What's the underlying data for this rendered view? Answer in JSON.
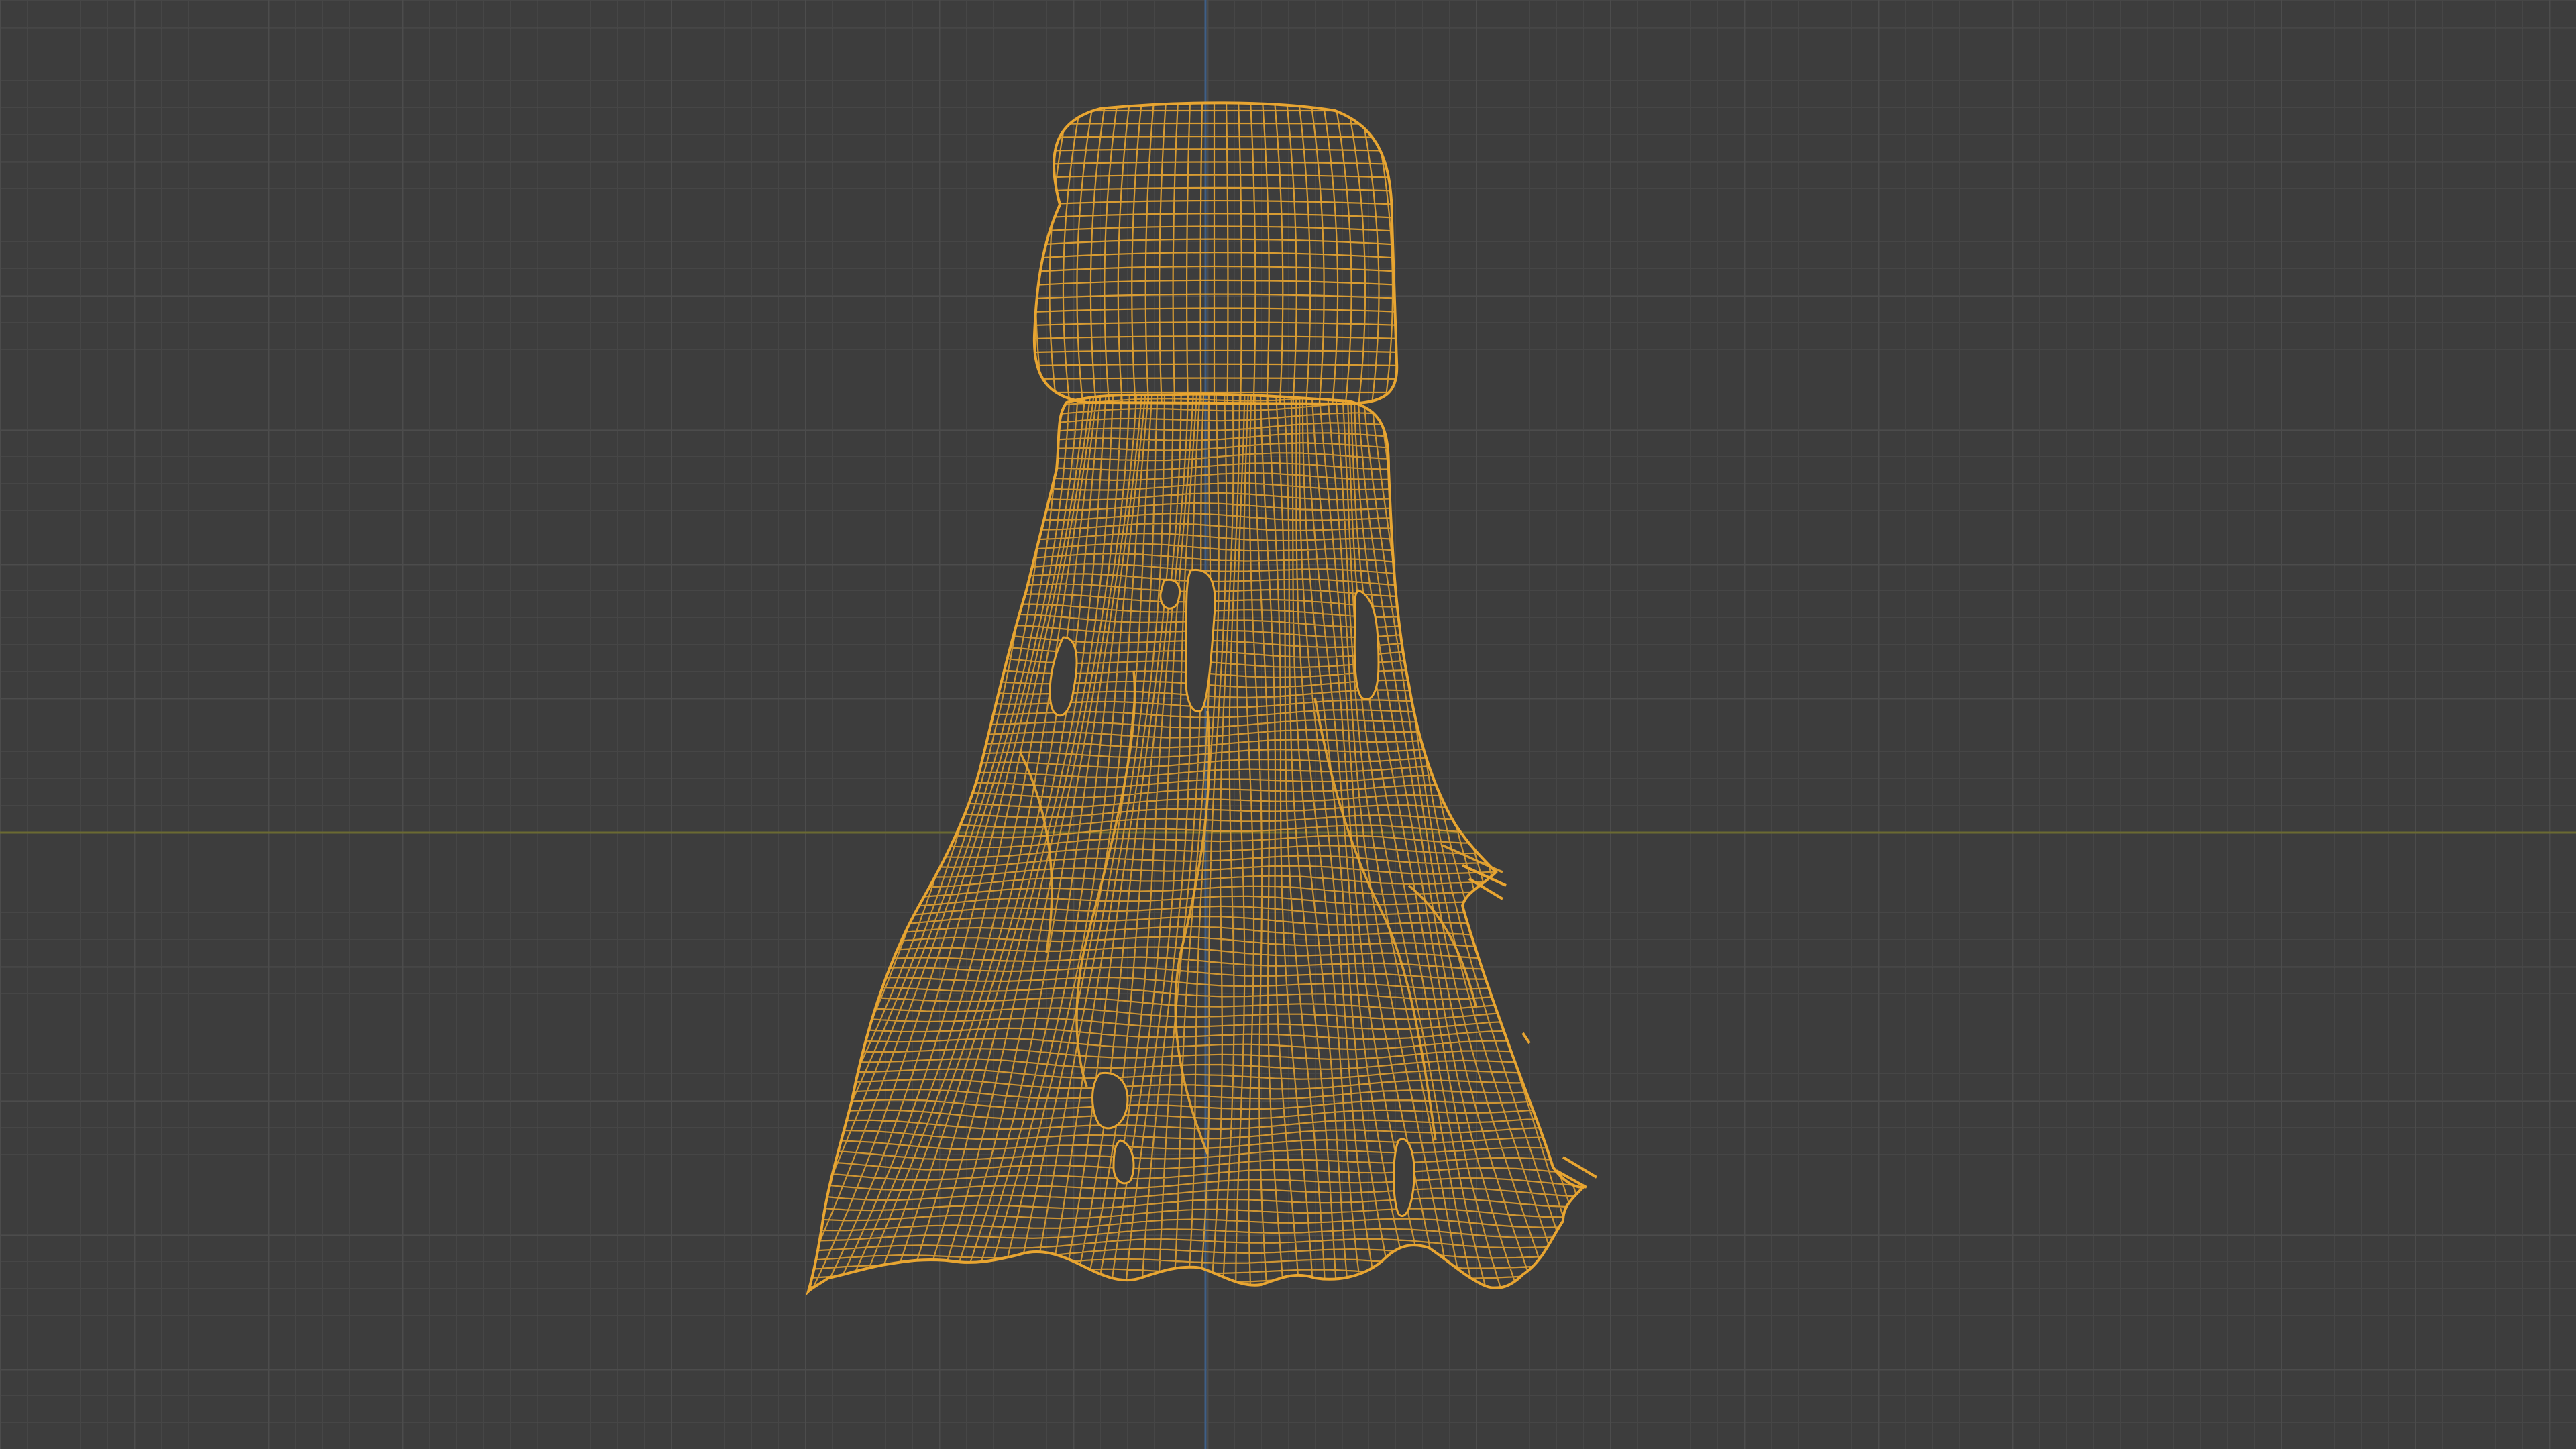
{
  "viewport": {
    "mode": "wireframe",
    "background_color": "#3d3d3d",
    "grid_minor_color": "#454545",
    "grid_major_color": "#4b4b4b",
    "axis_x_color": "#6e6a2e",
    "axis_z_color": "#3d5f8a",
    "wire_color": "#e8a531",
    "object": {
      "name": "tattered-cloth-ghost-mesh",
      "selected": true
    }
  }
}
